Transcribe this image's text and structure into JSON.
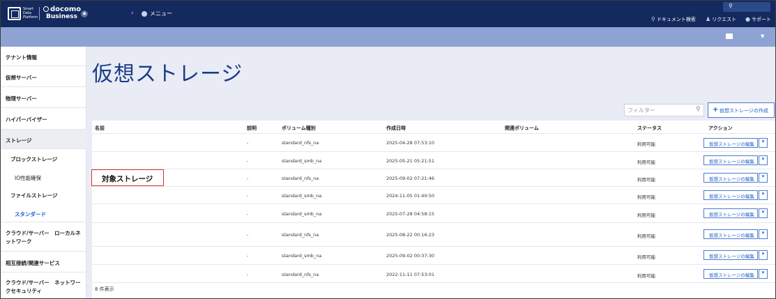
{
  "header": {
    "brand_small": "Smart Data Platform",
    "brand_name_1": "docomo",
    "brand_name_2": "Business",
    "menu_label": "メニュー",
    "doc_search": "ドキュメント検索",
    "request": "リクエスト",
    "support": "サポート",
    "user_icon": "user-icon",
    "search_icon": "search-icon",
    "bell_icon": "request-icon",
    "help_icon": "help-icon"
  },
  "sidebar": {
    "items": [
      {
        "label": "テナント情報"
      },
      {
        "label": "仮想サーバー"
      },
      {
        "label": "物理サーバー"
      },
      {
        "label": "ハイパーバイザー"
      },
      {
        "label": "ストレージ"
      },
      {
        "label": "ブロックストレージ"
      },
      {
        "label": "IO性能確保"
      },
      {
        "label": "ファイルストレージ"
      },
      {
        "label": "スタンダード"
      },
      {
        "label_1": "クラウド/サーバー　ローカルネ",
        "label_2": "ットワーク"
      },
      {
        "label": "相互接続/関連サービス"
      },
      {
        "label_1": "クラウド/サーバー　ネットワー",
        "label_2": "クセキュリティ"
      }
    ]
  },
  "main": {
    "title": "仮想ストレージ",
    "filter_placeholder": "フィルター",
    "create_button": "仮想ストレージの作成",
    "columns": [
      "名前",
      "説明",
      "ボリューム種別",
      "作成日時",
      "関連ボリューム",
      "ステータス",
      "アクション"
    ],
    "rows": [
      {
        "name": "",
        "desc": "-",
        "type": "standard_nfs_na",
        "created": "2025-04-28 07:53:10",
        "related": "",
        "status": "利用可能",
        "action": "仮想ストレージの編集"
      },
      {
        "name": "",
        "desc": "-",
        "type": "standard_smb_na",
        "created": "2025-05-21 05:21:51",
        "related": "",
        "status": "利用可能",
        "action": "仮想ストレージの編集"
      },
      {
        "name": "",
        "desc": "-",
        "type": "standard_nfs_na",
        "created": "2025-09-02 07:21:46",
        "related": "",
        "status": "利用可能",
        "action": "仮想ストレージの編集"
      },
      {
        "name": "",
        "desc": "-",
        "type": "standard_smb_na",
        "created": "2024-11-05 01:40:50",
        "related": "",
        "status": "利用可能",
        "action": "仮想ストレージの編集"
      },
      {
        "name": "",
        "desc": "-",
        "type": "standard_smb_na",
        "created": "2025-07-28 04:58:15",
        "related": "",
        "status": "利用可能",
        "action": "仮想ストレージの編集"
      },
      {
        "name": "",
        "desc": "-",
        "type": "standard_nfs_na",
        "created": "2025-08-22 00:16:23",
        "related": "",
        "status": "利用可能",
        "action": "仮想ストレージの編集"
      },
      {
        "name": "",
        "desc": "-",
        "type": "standard_smb_na",
        "created": "2025-09-02 00:37:30",
        "related": "",
        "status": "利用可能",
        "action": "仮想ストレージの編集"
      },
      {
        "name": "",
        "desc": "-",
        "type": "standard_nfs_na",
        "created": "2022-11-11 07:53:01",
        "related": "",
        "status": "利用可能",
        "action": "仮想ストレージの編集"
      }
    ],
    "count_label": "8 件表示"
  },
  "annotation": {
    "callout_text": "対象ストレージ",
    "callout_color": "#e03030"
  },
  "colors": {
    "header_bg": "#142a5e",
    "subbar_bg": "#8ea3d3",
    "title": "#1b3d86",
    "link": "#1a5cc9"
  }
}
